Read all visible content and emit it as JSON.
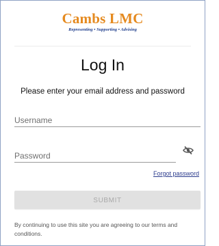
{
  "brand": {
    "name": "Cambs LMC",
    "tagline": "Representing • Supporting • Advising",
    "title_color": "#e58a1f",
    "tagline_color": "#1f3e8c"
  },
  "login": {
    "heading": "Log In",
    "instruction": "Please enter your email address and password",
    "username_placeholder": "Username",
    "password_placeholder": "Password",
    "password_toggle_icon": "eye-off-icon",
    "forgot_password": "Forgot password",
    "submit_label": "SUBMIT",
    "terms_text": "By continuing to use this site you are agreeing to our terms and conditions."
  }
}
